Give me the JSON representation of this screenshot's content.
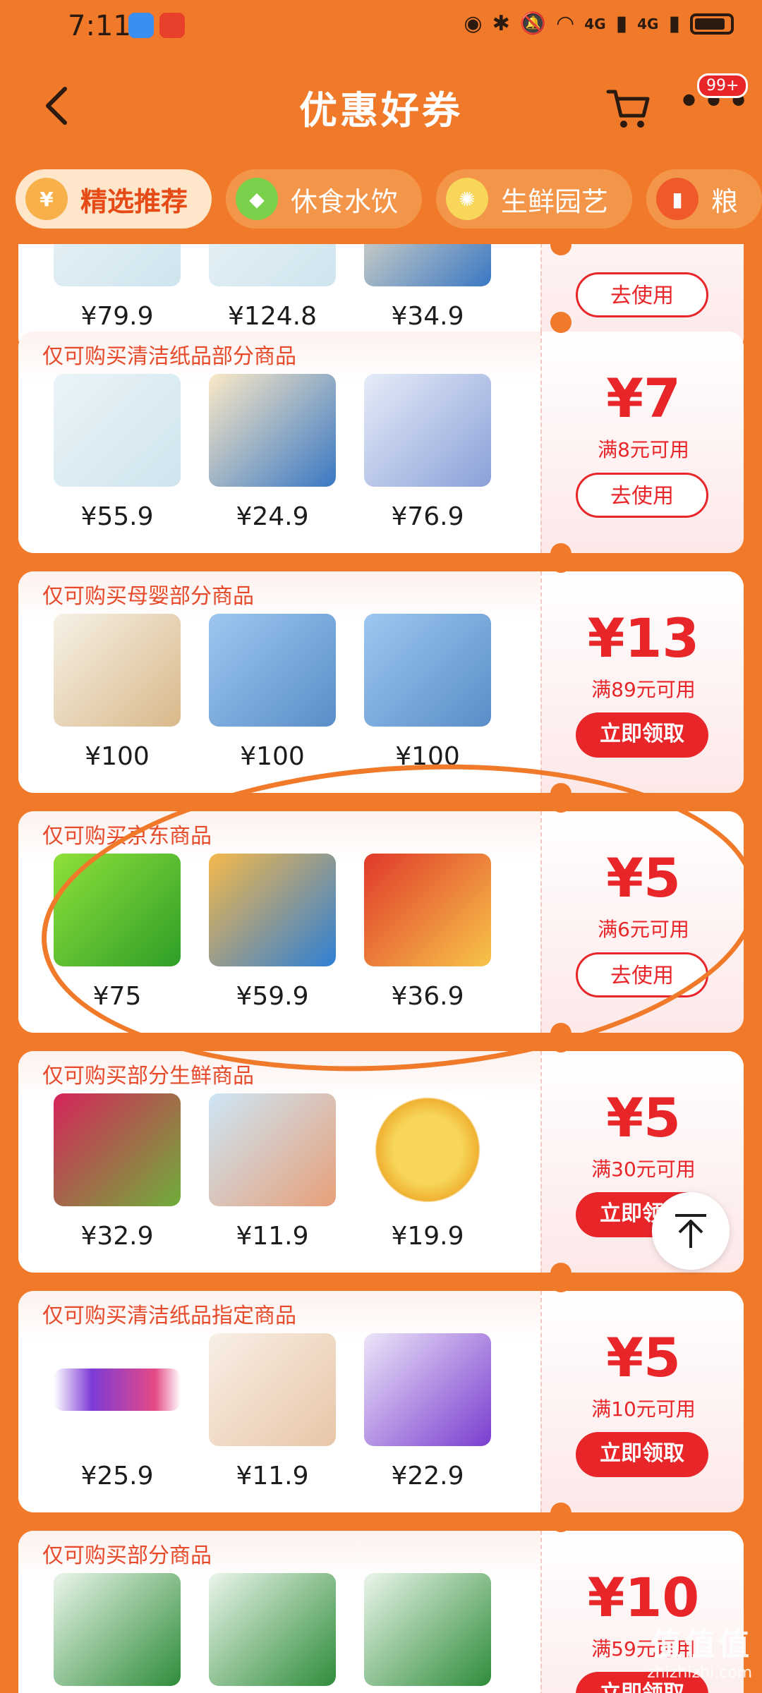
{
  "status_bar": {
    "time": "7:11",
    "network": "4G",
    "network2": "4G"
  },
  "header": {
    "title": "优惠好券",
    "badge": "99+"
  },
  "tabs": [
    {
      "label": "精选推荐",
      "active": true
    },
    {
      "label": "休食水饮",
      "active": false
    },
    {
      "label": "生鲜园艺",
      "active": false
    },
    {
      "label": "粮",
      "active": false
    }
  ],
  "coupons": [
    {
      "scope": "",
      "products": [
        {
          "price": "¥79.9"
        },
        {
          "price": "¥124.8"
        },
        {
          "price": "¥34.9"
        }
      ],
      "amount": "",
      "condition": "",
      "button": "去使用"
    },
    {
      "scope": "仅可购买清洁纸品部分商品",
      "products": [
        {
          "price": "¥55.9"
        },
        {
          "price": "¥24.9"
        },
        {
          "price": "¥76.9"
        }
      ],
      "amount": "¥7",
      "condition": "满8元可用",
      "button": "去使用"
    },
    {
      "scope": "仅可购买母婴部分商品",
      "products": [
        {
          "price": "¥100"
        },
        {
          "price": "¥100"
        },
        {
          "price": "¥100"
        }
      ],
      "amount": "¥13",
      "condition": "满89元可用",
      "button": "立即领取"
    },
    {
      "scope": "仅可购买京东商品",
      "products": [
        {
          "price": "¥75"
        },
        {
          "price": "¥59.9"
        },
        {
          "price": "¥36.9"
        }
      ],
      "amount": "¥5",
      "condition": "满6元可用",
      "button": "去使用"
    },
    {
      "scope": "仅可购买部分生鲜商品",
      "products": [
        {
          "price": "¥32.9"
        },
        {
          "price": "¥11.9"
        },
        {
          "price": "¥19.9"
        }
      ],
      "amount": "¥5",
      "condition": "满30元可用",
      "button": "立即领取"
    },
    {
      "scope": "仅可购买清洁纸品指定商品",
      "products": [
        {
          "price": "¥25.9"
        },
        {
          "price": "¥11.9"
        },
        {
          "price": "¥22.9"
        }
      ],
      "amount": "¥5",
      "condition": "满10元可用",
      "button": "立即领取"
    },
    {
      "scope": "仅可购买部分商品",
      "products": [
        {
          "price": ""
        },
        {
          "price": ""
        },
        {
          "price": ""
        }
      ],
      "amount": "¥10",
      "condition": "满59元可用",
      "button": "立即领取"
    }
  ],
  "watermark": {
    "line1": "值值值",
    "line2": "zhizhizhi.com"
  },
  "colors": {
    "brand_orange": "#f07a2a",
    "coupon_red": "#e8262a",
    "tab_active_bg": "#fde6c9"
  }
}
